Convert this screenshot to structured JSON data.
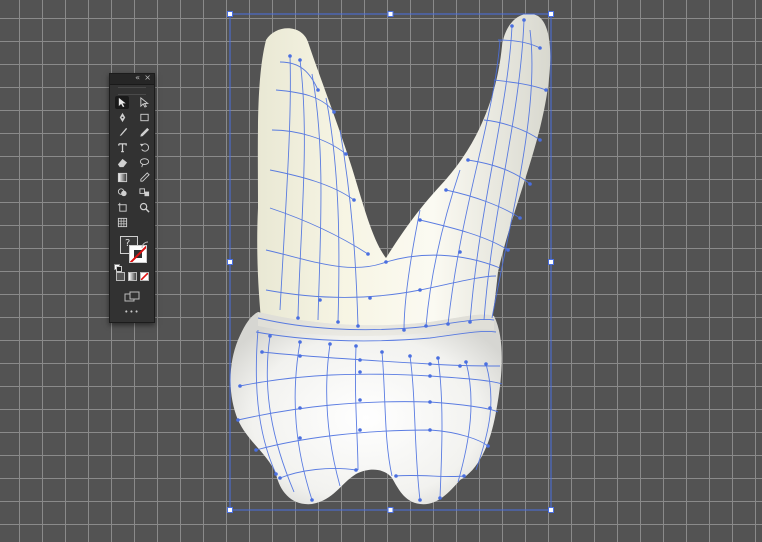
{
  "canvas": {
    "background": "#535353",
    "grid_color": "#8a8a8a",
    "selection_color": "#4a6fe0"
  },
  "toolbar": {
    "collapse_label": "«",
    "close_label": "×",
    "fill_label": "?",
    "more_label": "•••",
    "tools": [
      {
        "name": "selection-tool-icon",
        "active": true
      },
      {
        "name": "direct-selection-tool-icon"
      },
      {
        "name": "pen-tool-icon"
      },
      {
        "name": "rectangle-tool-icon"
      },
      {
        "name": "brush-tool-icon"
      },
      {
        "name": "pencil-tool-icon"
      },
      {
        "name": "type-tool-icon"
      },
      {
        "name": "rotate-tool-icon"
      },
      {
        "name": "eraser-tool-icon"
      },
      {
        "name": "lasso-tool-icon"
      },
      {
        "name": "gradient-tool-icon"
      },
      {
        "name": "eyedropper-tool-icon"
      },
      {
        "name": "shape-builder-tool-icon"
      },
      {
        "name": "blend-tool-icon"
      },
      {
        "name": "artboard-tool-icon"
      },
      {
        "name": "zoom-tool-icon"
      },
      {
        "name": "mesh-tool-icon"
      }
    ],
    "colors": {
      "panel": "#323232",
      "stroke_none": "#d11111"
    }
  }
}
